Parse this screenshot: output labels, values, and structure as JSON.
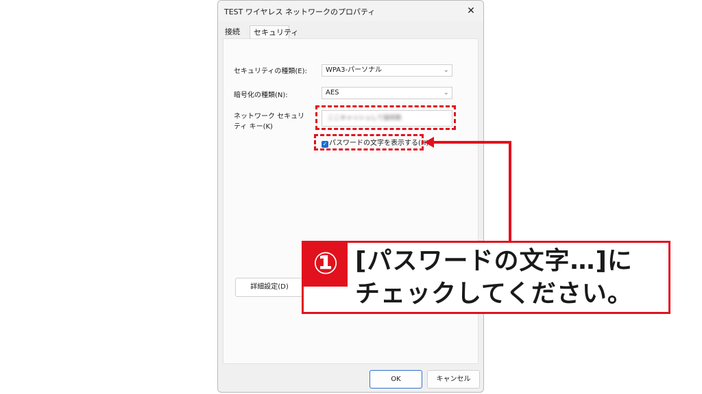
{
  "window": {
    "title": "TEST ワイヤレス ネットワークのプロパティ",
    "close_glyph": "✕"
  },
  "tabs": [
    {
      "label": "接続"
    },
    {
      "label": "セキュリティ"
    }
  ],
  "security": {
    "security_type_label": "セキュリティの種類(E):",
    "security_type_value": "WPA3-パーソナル",
    "encryption_type_label": "暗号化の種類(N):",
    "encryption_type_value": "AES",
    "network_key_label": "ネットワーク セキュリティ キー(K)",
    "network_key_value": "ここキャッシュして接続数",
    "show_password_label": "パスワードの文字を表示する(H)",
    "show_password_checked": true,
    "advanced_button_label": "詳細設定(D)"
  },
  "footer": {
    "ok_label": "OK",
    "cancel_label": "キャンセル"
  },
  "annotation": {
    "step_number": "①",
    "text_line1": "[パスワードの文字…]に",
    "text_line2": "チェックしてください。",
    "accent_color": "#e1111d"
  }
}
